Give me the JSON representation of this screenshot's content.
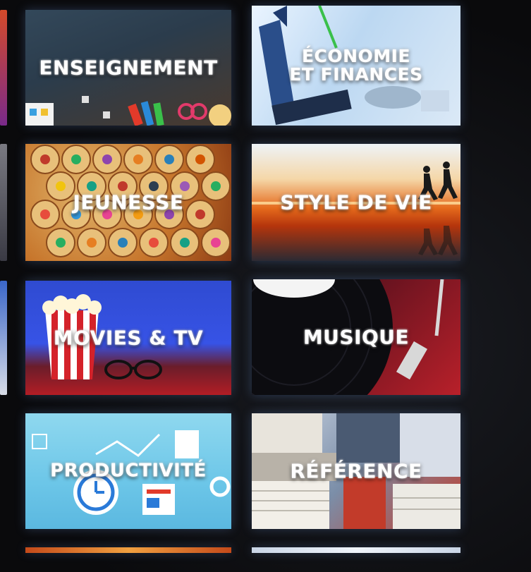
{
  "categories": [
    {
      "id": "enseignement",
      "label": "ENSEIGNEMENT"
    },
    {
      "id": "economie",
      "label": "ÉCONOMIE\nET FINANCES"
    },
    {
      "id": "jeunesse",
      "label": "JEUNESSE"
    },
    {
      "id": "style",
      "label": "STYLE DE VIE"
    },
    {
      "id": "movies",
      "label": "MOVIES & TV"
    },
    {
      "id": "musique",
      "label": "MUSIQUE"
    },
    {
      "id": "productivite",
      "label": "PRODUCTIVITÉ"
    },
    {
      "id": "reference",
      "label": "RÉFÉRENCE"
    }
  ]
}
